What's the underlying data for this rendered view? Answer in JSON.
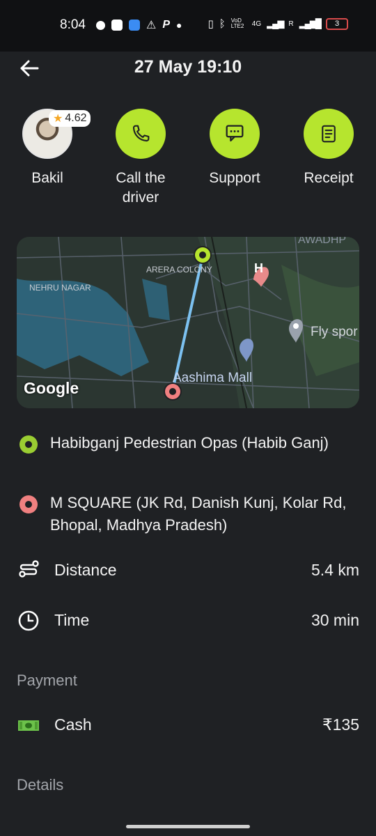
{
  "status_bar": {
    "time": "8:04",
    "battery": "3",
    "network_labels": [
      "VoD LTE2",
      "4G",
      "R"
    ]
  },
  "header": {
    "title": "27 May 19:10",
    "back_icon": "arrow-left-icon"
  },
  "driver": {
    "name": "Bakil",
    "rating": "4.62"
  },
  "actions": [
    {
      "label": "Call the driver",
      "icon": "phone-icon"
    },
    {
      "label": "Support",
      "icon": "chat-icon"
    },
    {
      "label": "Receipt",
      "icon": "receipt-icon"
    }
  ],
  "map": {
    "labels": {
      "awadh": "AWADHP",
      "arera": "ARERA COLONY",
      "nehru": "NEHRU NAGAR",
      "fly": "Fly spor",
      "mall": "Aashima Mall"
    },
    "brand": "Google"
  },
  "route": {
    "pickup": "Habibganj Pedestrian Opas (Habib Ganj)",
    "dropoff": "M SQUARE (JK Rd, Danish Kunj, Kolar Rd, Bhopal, Madhya Pradesh)"
  },
  "trip": {
    "distance_label": "Distance",
    "distance_value": "5.4 km",
    "time_label": "Time",
    "time_value": "30 min"
  },
  "payment": {
    "section_title": "Payment",
    "method": "Cash",
    "amount": "₹135"
  },
  "details": {
    "section_title": "Details"
  },
  "colors": {
    "accent": "#b6e52e",
    "pickup": "#9acd32",
    "dropoff": "#f08080",
    "background": "#1f2124"
  }
}
